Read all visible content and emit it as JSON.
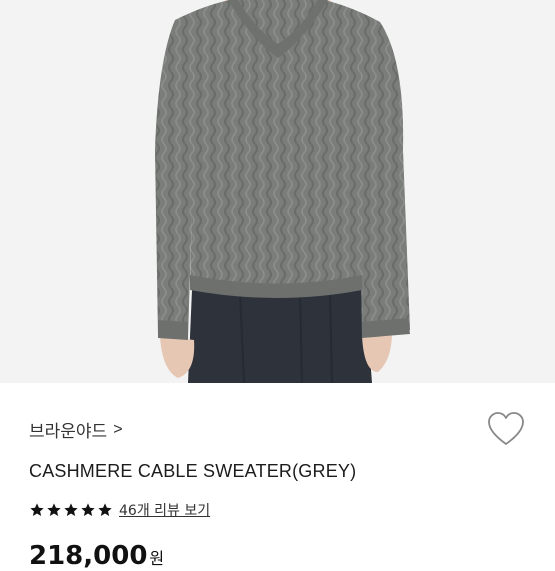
{
  "product": {
    "image_alt": "grey cable-knit v-neck sweater worn by model",
    "brand": "브라운야드",
    "brand_arrow": ">",
    "title": "CASHMERE CABLE SWEATER(GREY)",
    "rating": {
      "stars": 5,
      "max": 5
    },
    "review_link": "46개 리뷰 보기",
    "price": "218,000",
    "currency": "원"
  },
  "colors": {
    "sweater": "#7b7d7b",
    "jeans": "#2e333b",
    "background": "#f3f3f3",
    "star": "#111111"
  }
}
